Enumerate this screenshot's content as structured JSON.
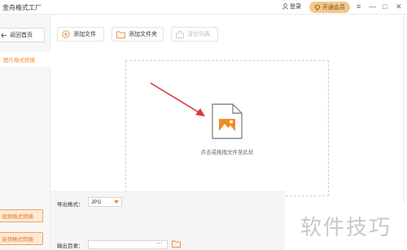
{
  "app": {
    "title": "金舟格式工厂",
    "login_label": "登录",
    "vip_label": "开通会员"
  },
  "window_controls": [
    "≡",
    "—",
    "□",
    "✕"
  ],
  "sidebar": {
    "back_label": "返回首页",
    "active_item": "图片格式转换",
    "bottom_items": [
      "视频格式转换",
      "音频格式转换"
    ]
  },
  "toolbar": {
    "add_file": "添加文件",
    "add_folder": "添加文件夹",
    "clear_list": "清空列表"
  },
  "dropzone": {
    "hint": "点击或拖拽文件至此处"
  },
  "output": {
    "format_label": "导出格式：",
    "format_value": "JPG",
    "dir_label": "输出目录：",
    "dir_value": "",
    "more_label": "···"
  },
  "watermark": "软件技巧",
  "colors": {
    "accent": "#f28b2a",
    "vip": "#f2c98a",
    "arrow": "#d9383a"
  }
}
